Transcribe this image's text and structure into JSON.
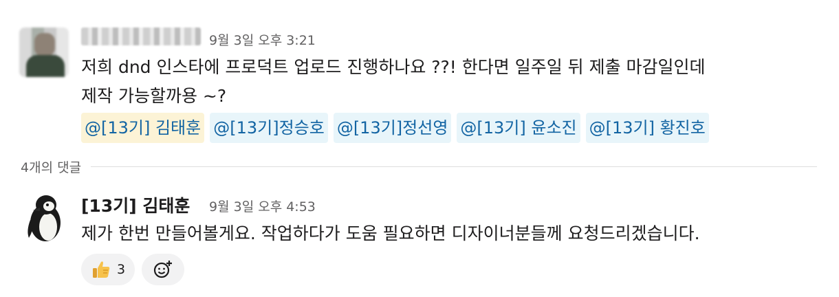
{
  "message1": {
    "timestamp": "9월 3일 오후 3:21",
    "line1": "저희 dnd 인스타에 프로덕트 업로드 진행하나요 ??! 한다면 일주일 뒤 제출 마감일인데",
    "line2": "제작 가능할까용 ~?",
    "mentions": [
      "@[13기] 김태훈",
      "@[13기]정승호",
      "@[13기]정선영",
      "@[13기] 윤소진",
      "@[13기] 황진호"
    ]
  },
  "thread": {
    "reply_count_label": "4개의 댓글"
  },
  "message2": {
    "author": "[13기] 김태훈",
    "timestamp": "9월 3일 오후 4:53",
    "text": "제가 한번 만들어볼게요. 작업하다가 도움 필요하면 디자이너분들께 요청드리겠습니다.",
    "reactions": [
      {
        "emoji": "thumbs-up",
        "count": "3"
      }
    ]
  }
}
